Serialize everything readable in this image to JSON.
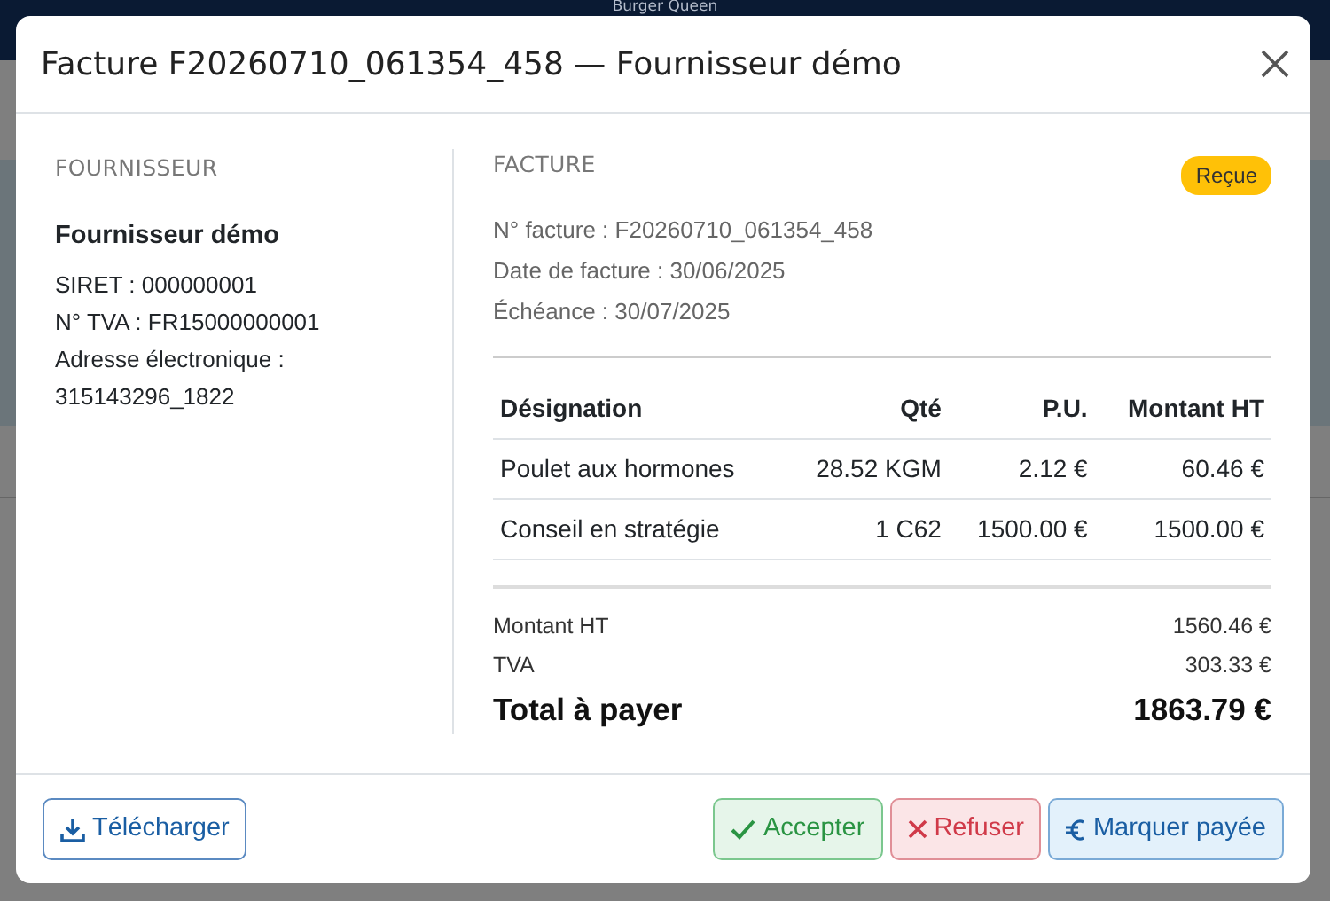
{
  "page": {
    "brand": "Burger Queen"
  },
  "modal": {
    "title": "Facture F20260710_061354_458 — Fournisseur démo",
    "supplier": {
      "heading": "FOURNISSEUR",
      "name": "Fournisseur démo",
      "lines": [
        "SIRET : 000000001",
        "N° TVA : FR15000000001",
        "Adresse électronique : 315143296_1822"
      ]
    },
    "invoice": {
      "heading": "FACTURE",
      "status": "Reçue",
      "details": [
        "N° facture : F20260710_061354_458",
        "Date de facture : 30/06/2025",
        "Échéance : 30/07/2025"
      ],
      "table": {
        "columns": [
          "Désignation",
          "Qté",
          "P.U.",
          "Montant HT"
        ],
        "rows": [
          [
            "Poulet aux hormones",
            "28.52 KGM",
            "2.12 €",
            "60.46 €"
          ],
          [
            "Conseil en stratégie",
            "1 C62",
            "1500.00 €",
            "1500.00 €"
          ]
        ]
      },
      "totals": [
        {
          "kind": "subtotal",
          "label": "Montant HT",
          "value": "1560.46 €"
        },
        {
          "kind": "subtotal",
          "label": "TVA",
          "value": "303.33 €"
        },
        {
          "kind": "grand",
          "label": "Total à payer",
          "value": "1863.79 €"
        }
      ]
    },
    "buttons": [
      {
        "kind": "download",
        "label": "Télécharger"
      },
      {
        "kind": "accept",
        "label": "Accepter"
      },
      {
        "kind": "refuse",
        "label": "Refuser"
      },
      {
        "kind": "pay",
        "label": "Marquer payée"
      }
    ]
  }
}
